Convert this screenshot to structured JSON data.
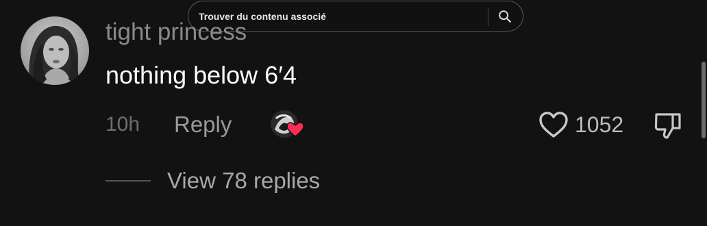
{
  "search": {
    "placeholder": "Trouver du contenu associé"
  },
  "comment": {
    "username": "tight princess",
    "text": "nothing below 6′4",
    "timestamp": "10h",
    "reply_label": "Reply",
    "like_count": "1052",
    "view_replies_label": "View 78 replies"
  },
  "icons": {
    "search": "search-icon",
    "like": "heart-outline-icon",
    "dislike": "thumbs-down-icon",
    "creator_liked": "creator-liked-heart-icon"
  },
  "colors": {
    "background": "#121212",
    "accent_heart": "#fe2c55",
    "username": "#8a8a8a",
    "text": "#ffffff"
  }
}
